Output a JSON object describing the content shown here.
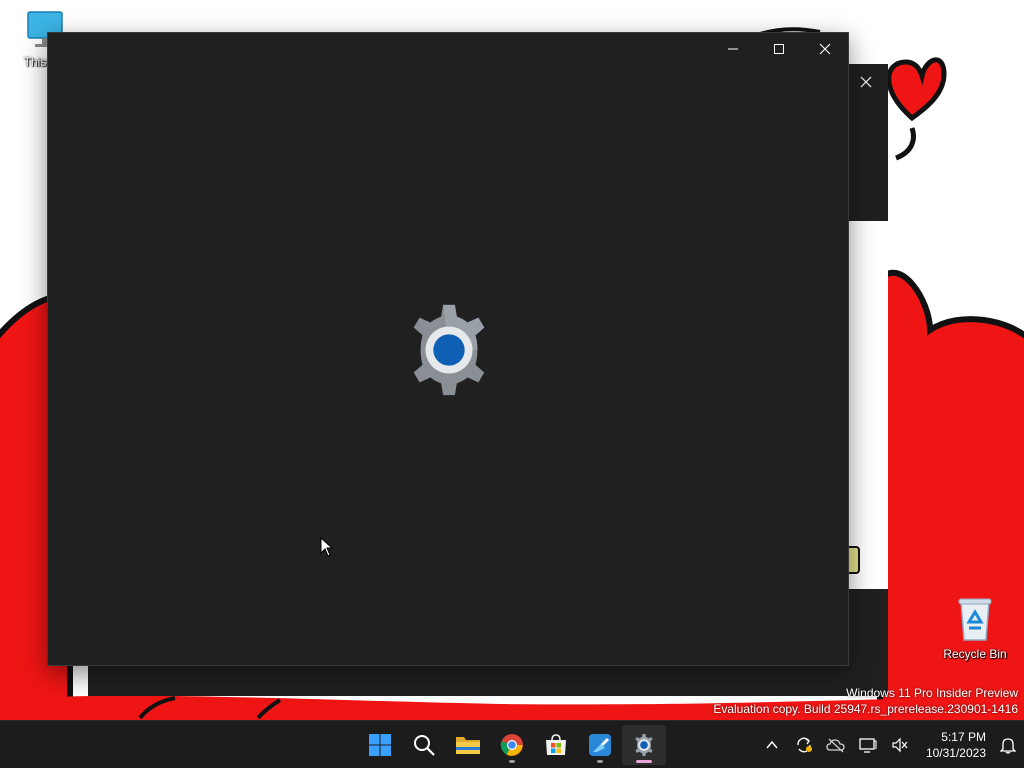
{
  "desktop": {
    "icons": [
      {
        "label": "This PC",
        "icon": "monitor-icon"
      },
      {
        "label": "Recycle Bin",
        "icon": "recycle-bin-icon"
      }
    ],
    "watermark": {
      "edition": "Windows 11 Pro Insider Preview",
      "build": "Evaluation copy. Build 25947.rs_prerelease.230901-1416"
    }
  },
  "settings_window": {
    "splash_icon": "settings-gear-icon",
    "caption_buttons": [
      "minimize",
      "maximize",
      "close"
    ]
  },
  "taskbar": {
    "apps": [
      {
        "name": "Start",
        "icon": "windows-start-icon",
        "running": false
      },
      {
        "name": "Search",
        "icon": "search-icon",
        "running": false
      },
      {
        "name": "File Explorer",
        "icon": "folder-icon",
        "running": false
      },
      {
        "name": "Google Chrome",
        "icon": "chrome-icon",
        "running": true
      },
      {
        "name": "Microsoft Store",
        "icon": "store-icon",
        "running": false
      },
      {
        "name": "Paint",
        "icon": "paint-icon",
        "running": true
      },
      {
        "name": "Settings",
        "icon": "settings-icon",
        "running": true,
        "active": true
      }
    ],
    "tray": [
      "chevron-up-icon",
      "sync-icon",
      "onedrive-icon",
      "display-icon",
      "volume-muted-icon"
    ],
    "clock": {
      "time": "5:17 PM",
      "date": "10/31/2023"
    }
  },
  "colors": {
    "window_bg": "#202020",
    "taskbar_bg": "#1c1c1c",
    "accent_blue": "#0f5fb4",
    "wallpaper_red": "#f01515"
  }
}
